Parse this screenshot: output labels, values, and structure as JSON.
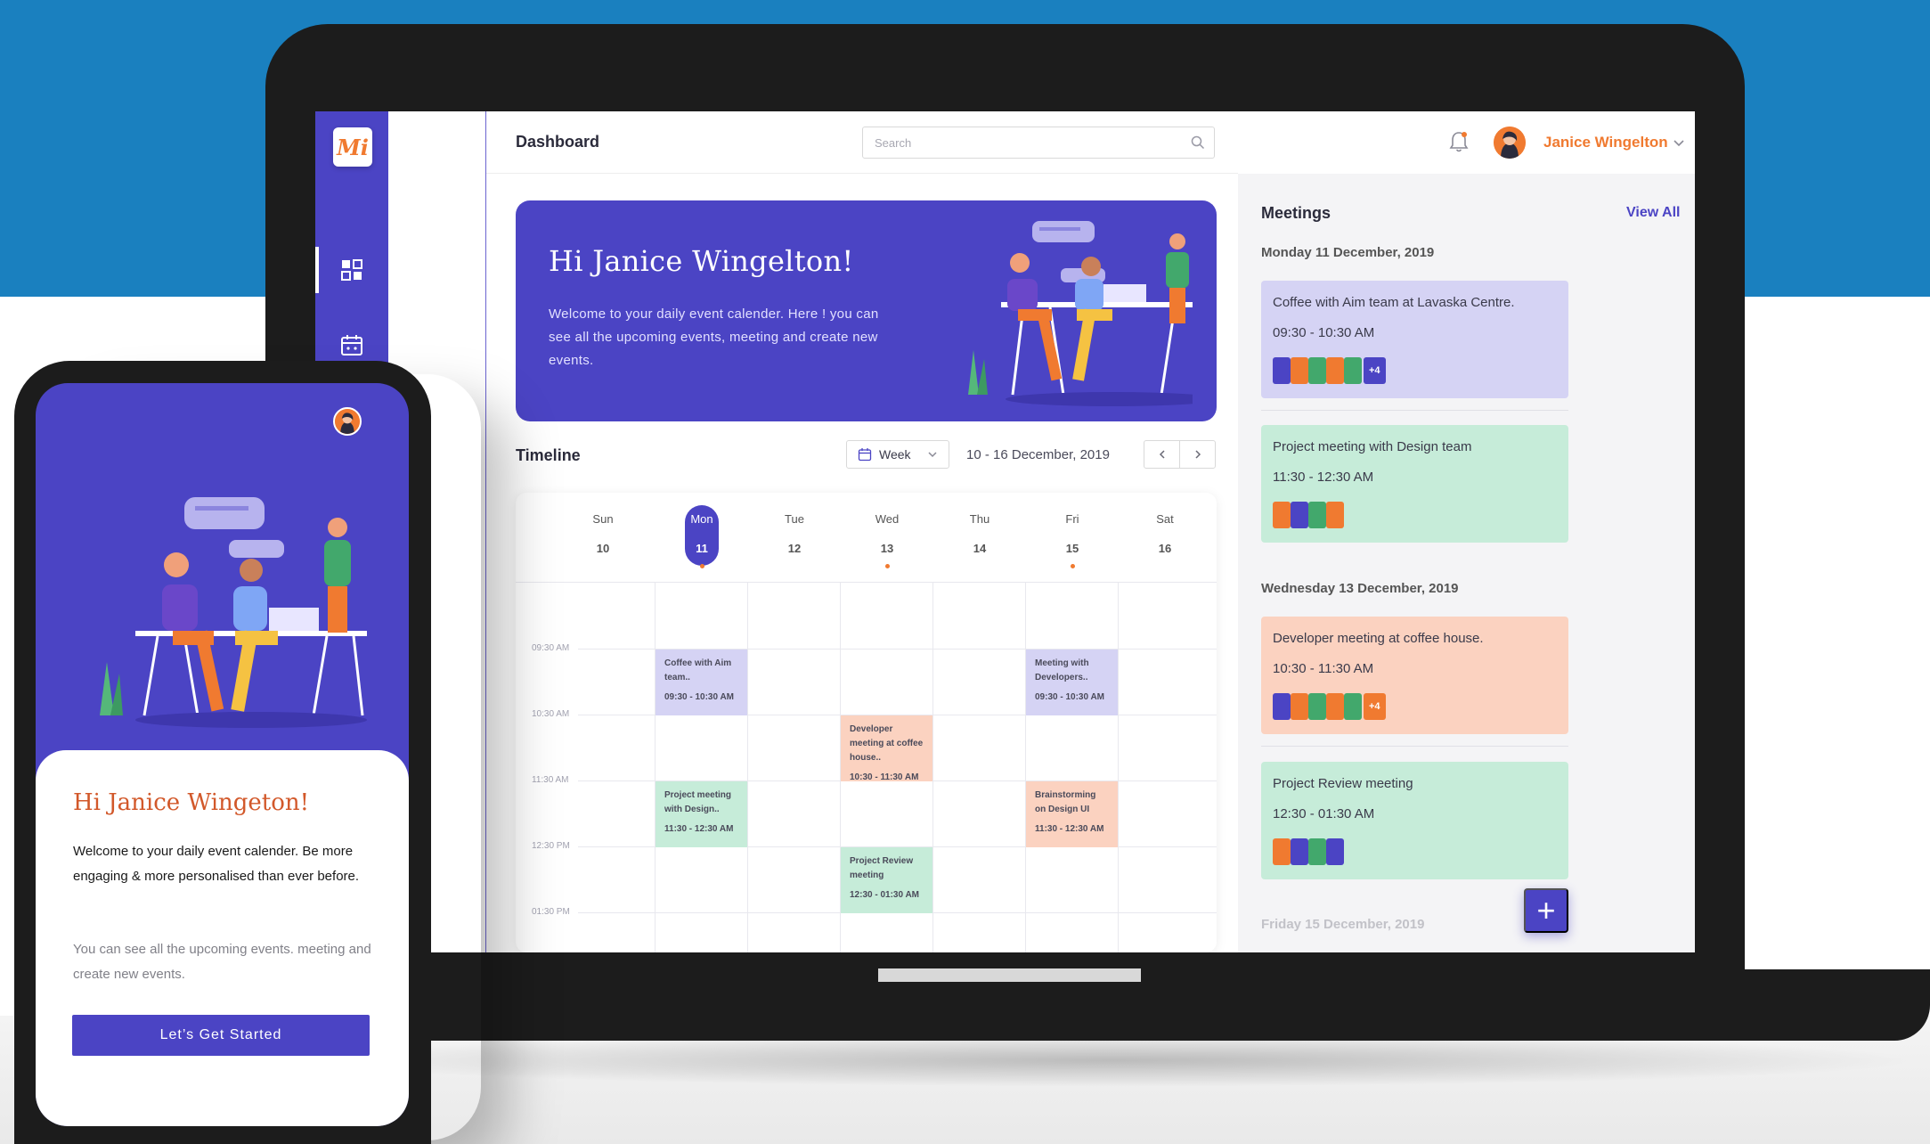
{
  "app": {
    "logo_text": "Mi"
  },
  "header": {
    "title": "Dashboard",
    "search_placeholder": "Search",
    "user_name": "Janice Wingelton"
  },
  "hero": {
    "greeting": "Hi Janice Wingelton!",
    "message": "Welcome to your daily event calender. Here ! you can see all the upcoming events, meeting and create new events."
  },
  "timeline": {
    "title": "Timeline",
    "view": "Week",
    "range": "10 - 16 December, 2019",
    "days": [
      {
        "name": "Sun",
        "num": "10"
      },
      {
        "name": "Mon",
        "num": "11"
      },
      {
        "name": "Tue",
        "num": "12"
      },
      {
        "name": "Wed",
        "num": "13"
      },
      {
        "name": "Thu",
        "num": "14"
      },
      {
        "name": "Fri",
        "num": "15"
      },
      {
        "name": "Sat",
        "num": "16"
      }
    ],
    "times": [
      "09:30 AM",
      "10:30 AM",
      "11:30 AM",
      "12:30 PM",
      "01:30 PM"
    ],
    "events": [
      {
        "title": "Coffee with Aim team..",
        "time": "09:30 - 10:30 AM"
      },
      {
        "title": "Meeting with Developers..",
        "time": "09:30 - 10:30 AM"
      },
      {
        "title": "Developer meeting at coffee house..",
        "time": "10:30 - 11:30 AM"
      },
      {
        "title": "Project meeting with Design..",
        "time": "11:30 - 12:30 AM"
      },
      {
        "title": "Brainstorming on Design UI",
        "time": "11:30 - 12:30 AM"
      },
      {
        "title": "Project Review meeting",
        "time": "12:30 - 01:30 AM"
      }
    ]
  },
  "meetings": {
    "title": "Meetings",
    "view_all": "View All",
    "dates": [
      "Monday 11 December, 2019",
      "Wednesday 13 December, 2019",
      "Friday 15 December, 2019"
    ],
    "items": [
      {
        "title": "Coffee with Aim team at Lavaska Centre.",
        "time": "09:30 - 10:30 AM",
        "more": "+4"
      },
      {
        "title": "Project meeting with Design team",
        "time": "11:30 - 12:30 AM"
      },
      {
        "title": "Developer meeting at coffee house.",
        "time": "10:30 - 11:30 AM",
        "more": "+4"
      },
      {
        "title": "Project Review meeting",
        "time": "12:30 - 01:30 AM"
      }
    ],
    "fab": "+"
  },
  "mobile": {
    "greeting": "Hi Janice Wingeton!",
    "intro": "Welcome to your daily event calender. Be more engaging & more personalised than ever before.",
    "sub": "You can see all the upcoming events. meeting and create new events.",
    "cta": "Let’s Get Started"
  },
  "colors": {
    "primary": "#4b44c4",
    "accent": "#f07a30",
    "backdrop": "#1a80bf",
    "event_purple": "#d5d3f4",
    "event_green": "#c6ecd9",
    "event_peach": "#fbd2c0"
  }
}
